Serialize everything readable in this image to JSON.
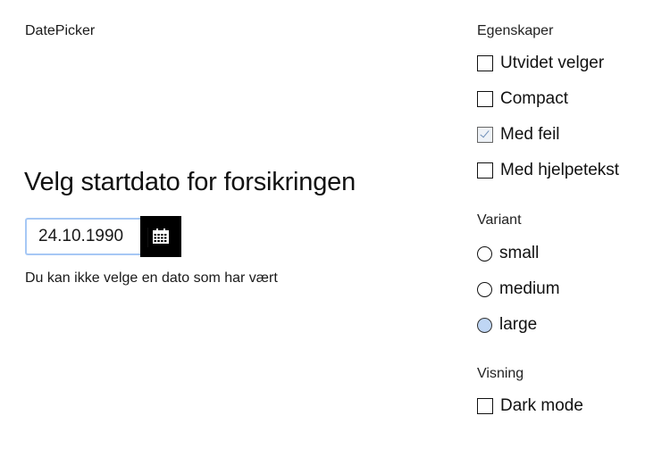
{
  "demo": {
    "title": "DatePicker"
  },
  "field": {
    "label": "Velg startdato for forsikringen",
    "value": "24.10.1990",
    "error": "Du kan ikke velge en dato som har vært"
  },
  "panel": {
    "properties_title": "Egenskaper",
    "properties": [
      {
        "label": "Utvidet velger",
        "checked": false
      },
      {
        "label": "Compact",
        "checked": false
      },
      {
        "label": "Med feil",
        "checked": true
      },
      {
        "label": "Med hjelpetekst",
        "checked": false
      }
    ],
    "variant_title": "Variant",
    "variants": [
      {
        "label": "small",
        "selected": false
      },
      {
        "label": "medium",
        "selected": false
      },
      {
        "label": "large",
        "selected": true
      }
    ],
    "display_title": "Visning",
    "display": [
      {
        "label": "Dark mode",
        "checked": false
      }
    ]
  },
  "colors": {
    "focus_border": "#a6c8f5",
    "button_bg": "#000000",
    "radio_selected": "#bfd6f4"
  },
  "icons": {
    "calendar": "calendar-icon"
  }
}
